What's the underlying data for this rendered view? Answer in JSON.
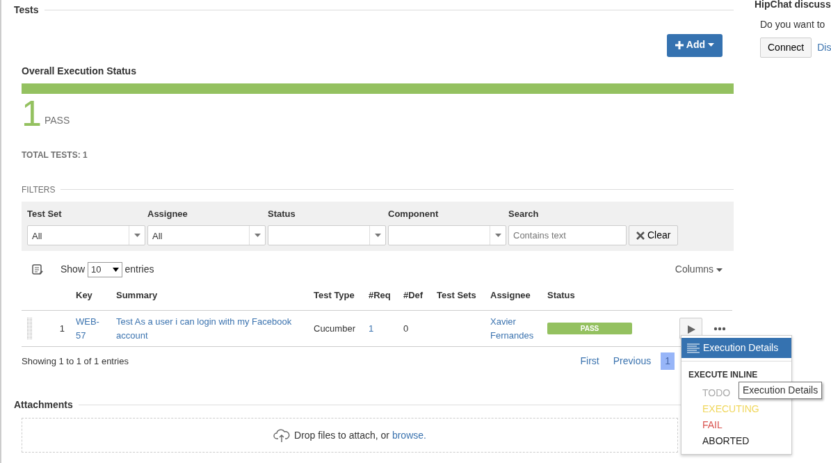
{
  "section_title": "Tests",
  "add_button": {
    "label": "Add"
  },
  "overall": {
    "title": "Overall Execution Status",
    "segments": [
      {
        "level": 1,
        "color": "#94c160"
      }
    ],
    "count": "1",
    "count_label": "PASS",
    "total": "TOTAL TESTS: 1"
  },
  "filters": {
    "title": "FILTERS",
    "fields": [
      {
        "kind": "select",
        "label": "Test Set",
        "value": "All"
      },
      {
        "kind": "select",
        "label": "Assignee",
        "value": "All"
      },
      {
        "kind": "select",
        "label": "Status"
      },
      {
        "kind": "select",
        "label": "Component"
      },
      {
        "kind": "text",
        "label": "Search",
        "placeholder": "Contains text"
      }
    ],
    "clear_button": "Clear"
  },
  "length": {
    "before": "Show",
    "value": "10",
    "after": "entries"
  },
  "columns_button": "Columns",
  "table": {
    "columns": [
      "Key",
      "Summary",
      "Test Type",
      "#Req",
      "#Def",
      "Test Sets",
      "Assignee",
      "Status"
    ],
    "rows": [
      {
        "index": "1",
        "key": "WEB-57",
        "summary": "Test As a user i can login with my Facebook account",
        "test_type": "Cucumber",
        "req": "1",
        "def": "0",
        "assignee": "Xavier Fernandes",
        "status": "PASS",
        "color": "#94c160"
      }
    ]
  },
  "info": "Showing 1 to 1 of 1 entries",
  "pagination": [
    {
      "label": "First",
      "selected": false
    },
    {
      "label": "Previous",
      "selected": false
    },
    {
      "label": "1",
      "selected": true
    }
  ],
  "action_menu": {
    "details": "Execution Details",
    "section": "EXECUTE INLINE",
    "options": [
      {
        "label": "TODO",
        "color": "#aaaaaa"
      },
      {
        "label": "EXECUTING",
        "color": "#f0d75c"
      },
      {
        "label": "FAIL",
        "color": "#d9534f"
      },
      {
        "label": "ABORTED",
        "color": "#222222"
      }
    ]
  },
  "tooltip": "Execution Details",
  "attachments": {
    "title": "Attachments",
    "drop_text": "Drop files to attach, or ",
    "browse": "browse."
  },
  "side_panel": {
    "title": "HipChat discuss",
    "text": "Do you want to",
    "connect": "Connect",
    "link": "Dis"
  }
}
